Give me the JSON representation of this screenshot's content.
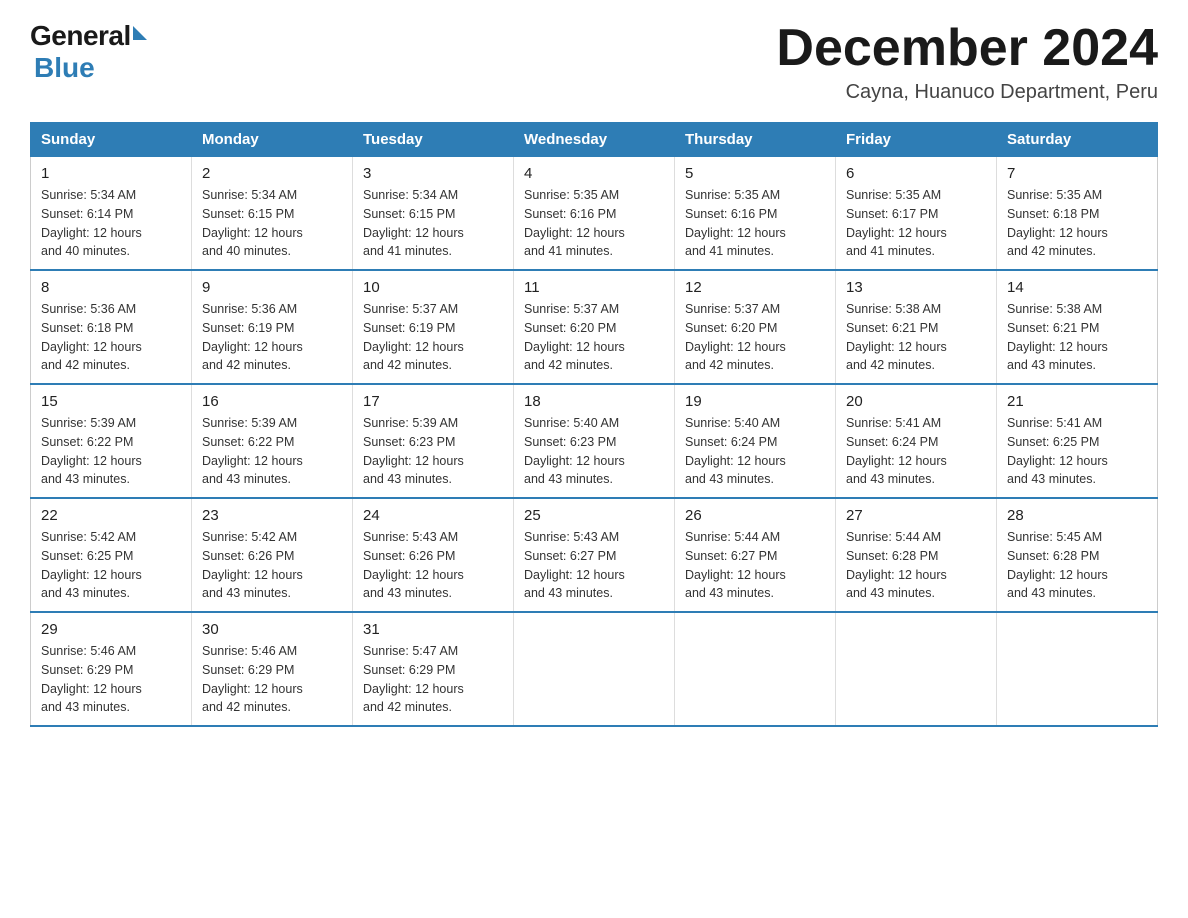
{
  "logo": {
    "general": "General",
    "blue": "Blue"
  },
  "title": "December 2024",
  "location": "Cayna, Huanuco Department, Peru",
  "weekdays": [
    "Sunday",
    "Monday",
    "Tuesday",
    "Wednesday",
    "Thursday",
    "Friday",
    "Saturday"
  ],
  "weeks": [
    [
      {
        "day": "1",
        "sunrise": "5:34 AM",
        "sunset": "6:14 PM",
        "daylight": "12 hours and 40 minutes."
      },
      {
        "day": "2",
        "sunrise": "5:34 AM",
        "sunset": "6:15 PM",
        "daylight": "12 hours and 40 minutes."
      },
      {
        "day": "3",
        "sunrise": "5:34 AM",
        "sunset": "6:15 PM",
        "daylight": "12 hours and 41 minutes."
      },
      {
        "day": "4",
        "sunrise": "5:35 AM",
        "sunset": "6:16 PM",
        "daylight": "12 hours and 41 minutes."
      },
      {
        "day": "5",
        "sunrise": "5:35 AM",
        "sunset": "6:16 PM",
        "daylight": "12 hours and 41 minutes."
      },
      {
        "day": "6",
        "sunrise": "5:35 AM",
        "sunset": "6:17 PM",
        "daylight": "12 hours and 41 minutes."
      },
      {
        "day": "7",
        "sunrise": "5:35 AM",
        "sunset": "6:18 PM",
        "daylight": "12 hours and 42 minutes."
      }
    ],
    [
      {
        "day": "8",
        "sunrise": "5:36 AM",
        "sunset": "6:18 PM",
        "daylight": "12 hours and 42 minutes."
      },
      {
        "day": "9",
        "sunrise": "5:36 AM",
        "sunset": "6:19 PM",
        "daylight": "12 hours and 42 minutes."
      },
      {
        "day": "10",
        "sunrise": "5:37 AM",
        "sunset": "6:19 PM",
        "daylight": "12 hours and 42 minutes."
      },
      {
        "day": "11",
        "sunrise": "5:37 AM",
        "sunset": "6:20 PM",
        "daylight": "12 hours and 42 minutes."
      },
      {
        "day": "12",
        "sunrise": "5:37 AM",
        "sunset": "6:20 PM",
        "daylight": "12 hours and 42 minutes."
      },
      {
        "day": "13",
        "sunrise": "5:38 AM",
        "sunset": "6:21 PM",
        "daylight": "12 hours and 42 minutes."
      },
      {
        "day": "14",
        "sunrise": "5:38 AM",
        "sunset": "6:21 PM",
        "daylight": "12 hours and 43 minutes."
      }
    ],
    [
      {
        "day": "15",
        "sunrise": "5:39 AM",
        "sunset": "6:22 PM",
        "daylight": "12 hours and 43 minutes."
      },
      {
        "day": "16",
        "sunrise": "5:39 AM",
        "sunset": "6:22 PM",
        "daylight": "12 hours and 43 minutes."
      },
      {
        "day": "17",
        "sunrise": "5:39 AM",
        "sunset": "6:23 PM",
        "daylight": "12 hours and 43 minutes."
      },
      {
        "day": "18",
        "sunrise": "5:40 AM",
        "sunset": "6:23 PM",
        "daylight": "12 hours and 43 minutes."
      },
      {
        "day": "19",
        "sunrise": "5:40 AM",
        "sunset": "6:24 PM",
        "daylight": "12 hours and 43 minutes."
      },
      {
        "day": "20",
        "sunrise": "5:41 AM",
        "sunset": "6:24 PM",
        "daylight": "12 hours and 43 minutes."
      },
      {
        "day": "21",
        "sunrise": "5:41 AM",
        "sunset": "6:25 PM",
        "daylight": "12 hours and 43 minutes."
      }
    ],
    [
      {
        "day": "22",
        "sunrise": "5:42 AM",
        "sunset": "6:25 PM",
        "daylight": "12 hours and 43 minutes."
      },
      {
        "day": "23",
        "sunrise": "5:42 AM",
        "sunset": "6:26 PM",
        "daylight": "12 hours and 43 minutes."
      },
      {
        "day": "24",
        "sunrise": "5:43 AM",
        "sunset": "6:26 PM",
        "daylight": "12 hours and 43 minutes."
      },
      {
        "day": "25",
        "sunrise": "5:43 AM",
        "sunset": "6:27 PM",
        "daylight": "12 hours and 43 minutes."
      },
      {
        "day": "26",
        "sunrise": "5:44 AM",
        "sunset": "6:27 PM",
        "daylight": "12 hours and 43 minutes."
      },
      {
        "day": "27",
        "sunrise": "5:44 AM",
        "sunset": "6:28 PM",
        "daylight": "12 hours and 43 minutes."
      },
      {
        "day": "28",
        "sunrise": "5:45 AM",
        "sunset": "6:28 PM",
        "daylight": "12 hours and 43 minutes."
      }
    ],
    [
      {
        "day": "29",
        "sunrise": "5:46 AM",
        "sunset": "6:29 PM",
        "daylight": "12 hours and 43 minutes."
      },
      {
        "day": "30",
        "sunrise": "5:46 AM",
        "sunset": "6:29 PM",
        "daylight": "12 hours and 42 minutes."
      },
      {
        "day": "31",
        "sunrise": "5:47 AM",
        "sunset": "6:29 PM",
        "daylight": "12 hours and 42 minutes."
      },
      null,
      null,
      null,
      null
    ]
  ],
  "labels": {
    "sunrise": "Sunrise:",
    "sunset": "Sunset:",
    "daylight": "Daylight: 12 hours"
  },
  "colors": {
    "header_bg": "#2e7db5",
    "border": "#2e7db5",
    "logo_blue": "#2e7db5"
  }
}
